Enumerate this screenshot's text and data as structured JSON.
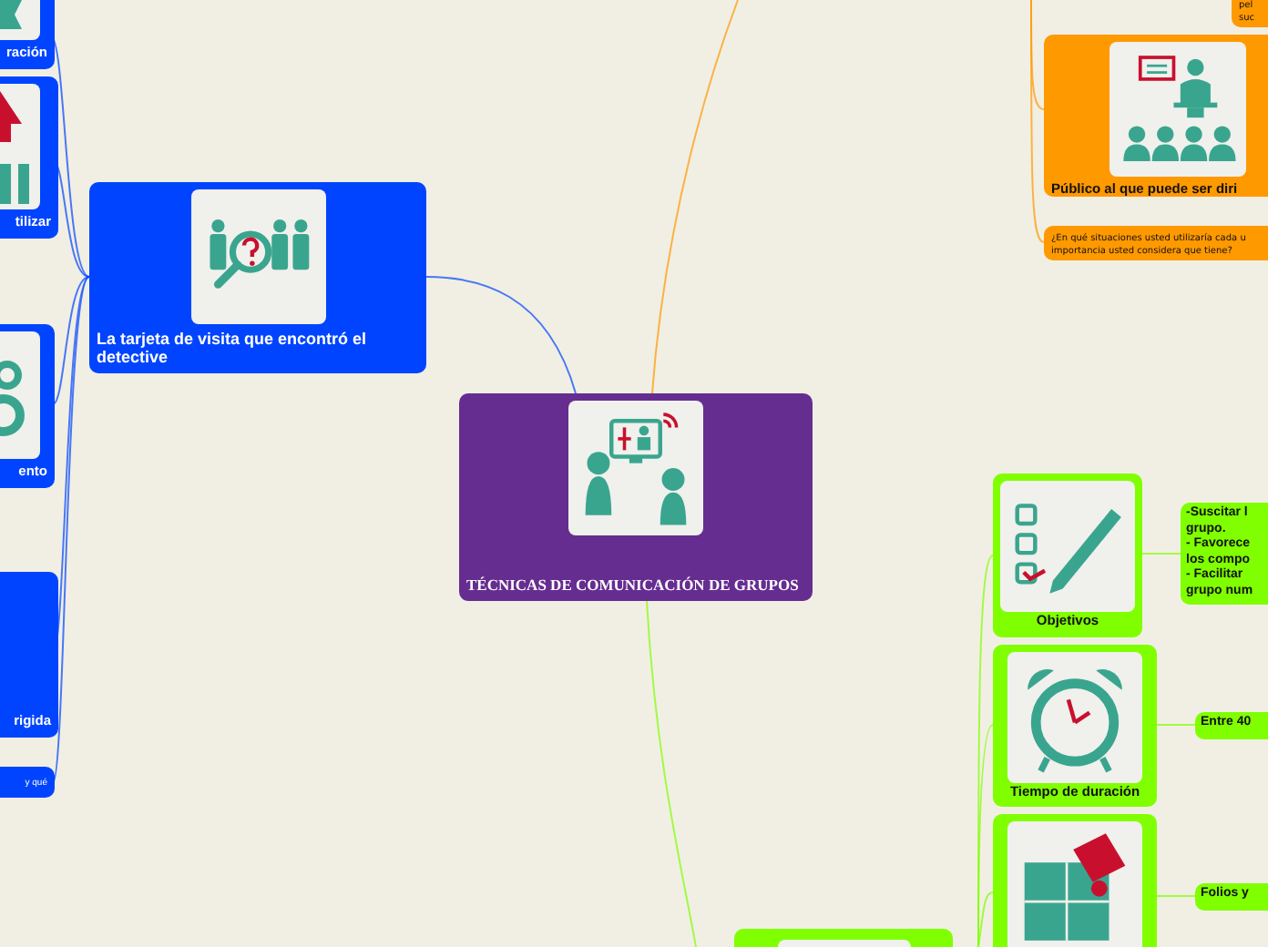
{
  "center": {
    "color": "#662d91",
    "title": "TÉCNICAS DE COMUNICACIÓN DE GRUPOS"
  },
  "left_branch": {
    "color": "#0044ff",
    "title": "La tarjeta de visita que encontró el detective",
    "subtopics": [
      {
        "kind": "image",
        "title": "ración"
      },
      {
        "kind": "image",
        "title": "tilizar"
      },
      {
        "kind": "image",
        "title": "ento"
      },
      {
        "kind": "plain",
        "title": "rigida"
      },
      {
        "kind": "note",
        "title": "y qué"
      }
    ]
  },
  "top_branch": {
    "color": "#ff9900",
    "subtopics": [
      {
        "kind": "note",
        "title": "pel\nsuc"
      },
      {
        "kind": "image",
        "title": "Público al que puede ser diri"
      },
      {
        "kind": "note",
        "title": "¿En qué situaciones usted utilizaría cada u\nimportancia usted considera que tiene?"
      }
    ]
  },
  "bottom_branch": {
    "color": "#80ff00",
    "subtopics": [
      {
        "kind": "image",
        "title": "Objetivos",
        "detail": "-Suscitar l\ngrupo.\n- Favorece\nlos compo\n- Facilitar\ngrupo num"
      },
      {
        "kind": "image",
        "title": "Tiempo de duración",
        "detail": "Entre 40"
      },
      {
        "kind": "image",
        "detail": "Folios y"
      }
    ]
  }
}
